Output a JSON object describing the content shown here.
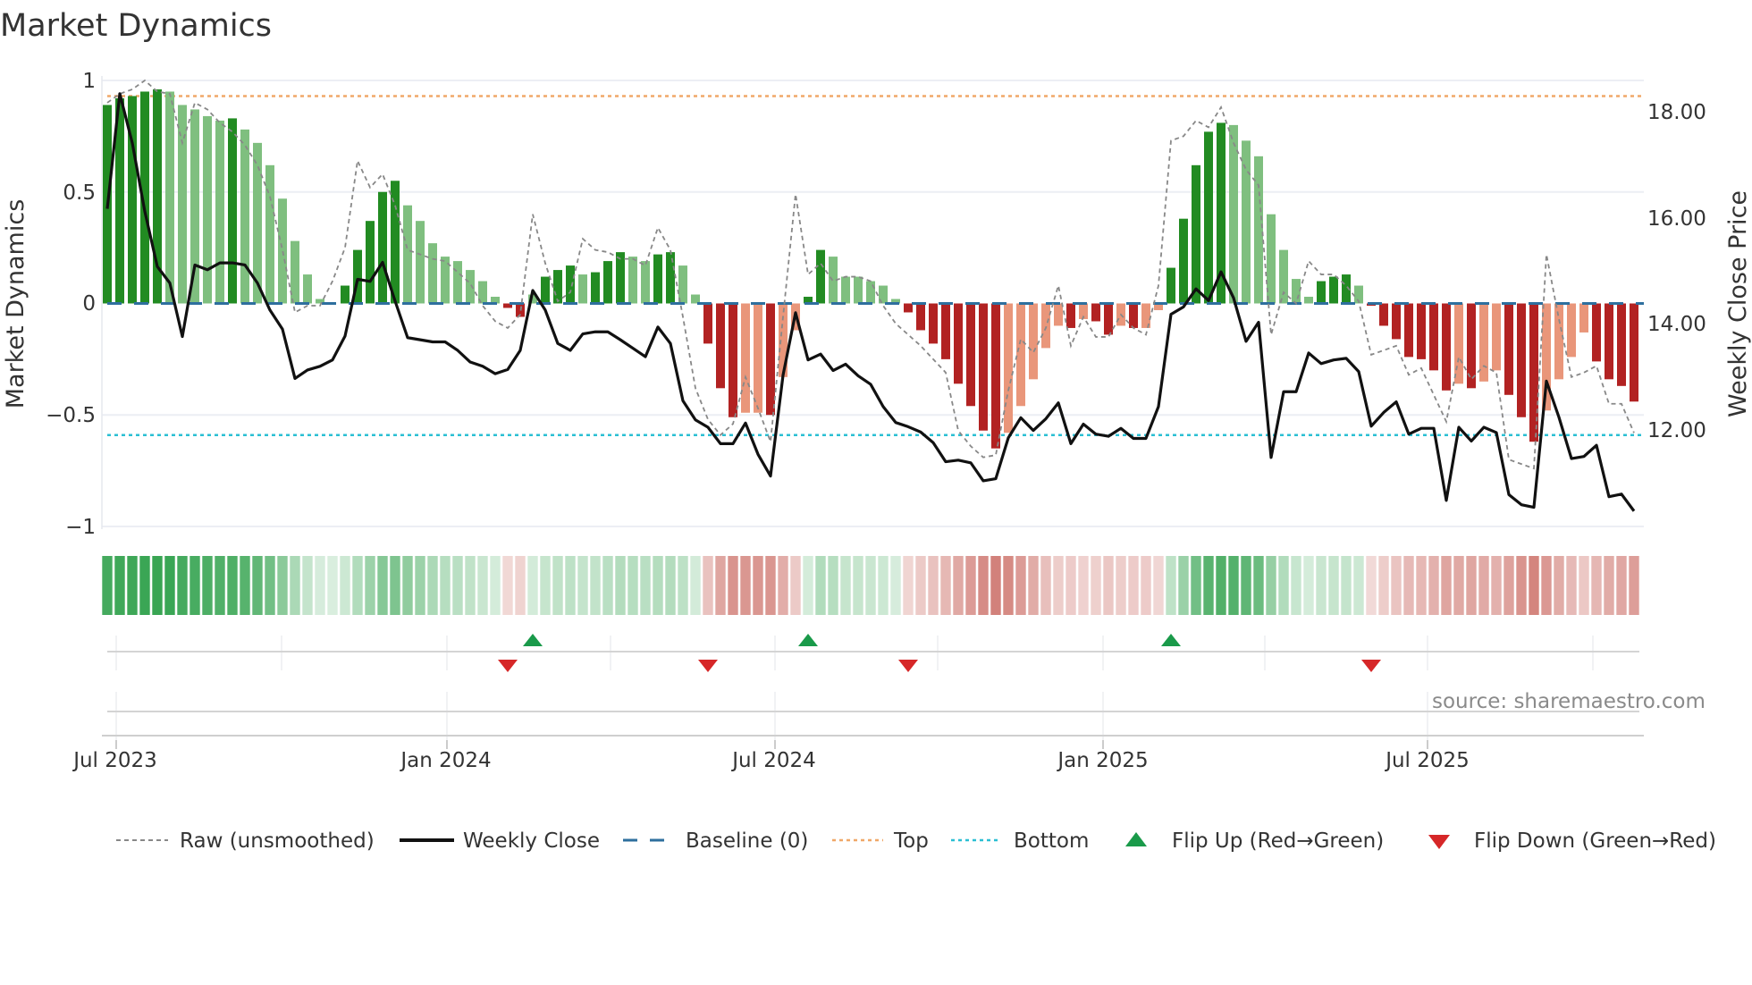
{
  "chart_data": {
    "type": "bar",
    "title": "Market Dynamics",
    "ylabel": "Market Dynamics",
    "ylabel_right": "Weekly Close Price",
    "ylim": [
      -1,
      1
    ],
    "ylim_right": [
      10.18,
      18.59
    ],
    "yticks_left": [
      "1",
      "0.5",
      "0",
      "−0.5",
      "−1"
    ],
    "yticks_left_values": [
      1,
      0.5,
      0,
      -0.5,
      -1
    ],
    "yticks_right": [
      "18.00",
      "16.00",
      "14.00",
      "12.00"
    ],
    "yticks_right_values": [
      18,
      16,
      14,
      12
    ],
    "xticks": [
      "Jul 2023",
      "Jan 2024",
      "Jul 2024",
      "Jan 2025",
      "Jul 2025"
    ],
    "xtick_week_index": [
      0.6,
      27,
      53.2,
      79.4,
      105.4
    ],
    "grid": true,
    "frequency": "weekly",
    "top_level": 0.93,
    "bottom_level": -0.59,
    "baseline": 0,
    "momentum": [
      0.89,
      0.92,
      0.93,
      0.95,
      0.96,
      0.95,
      0.89,
      0.87,
      0.84,
      0.82,
      0.83,
      0.78,
      0.72,
      0.62,
      0.47,
      0.28,
      0.13,
      0.02,
      0.0,
      0.08,
      0.24,
      0.37,
      0.5,
      0.55,
      0.44,
      0.37,
      0.27,
      0.21,
      0.19,
      0.15,
      0.1,
      0.03,
      -0.02,
      -0.06,
      0.04,
      0.12,
      0.15,
      0.17,
      0.13,
      0.14,
      0.19,
      0.23,
      0.21,
      0.19,
      0.22,
      0.23,
      0.17,
      0.04,
      -0.18,
      -0.38,
      -0.51,
      -0.49,
      -0.49,
      -0.5,
      -0.33,
      -0.12,
      0.03,
      0.24,
      0.21,
      0.12,
      0.12,
      0.1,
      0.08,
      0.02,
      -0.04,
      -0.12,
      -0.18,
      -0.25,
      -0.36,
      -0.46,
      -0.57,
      -0.65,
      -0.58,
      -0.46,
      -0.34,
      -0.2,
      -0.1,
      -0.11,
      -0.07,
      -0.08,
      -0.14,
      -0.1,
      -0.11,
      -0.11,
      -0.03,
      0.16,
      0.38,
      0.62,
      0.77,
      0.81,
      0.8,
      0.73,
      0.66,
      0.4,
      0.24,
      0.11,
      0.03,
      0.1,
      0.12,
      0.13,
      0.08,
      -0.01,
      -0.1,
      -0.16,
      -0.24,
      -0.25,
      -0.3,
      -0.39,
      -0.36,
      -0.38,
      -0.35,
      -0.3,
      -0.41,
      -0.51,
      -0.62,
      -0.48,
      -0.34,
      -0.24,
      -0.13,
      -0.26,
      -0.34,
      -0.37,
      -0.44
    ],
    "shades": "dddddlllll dlllllllld ddddllllll llddldddld ddllddlldd dlldllddll lllldddddd ddllllldld dldllddddd lllllllddd ldddddddld lldddlllld ddd",
    "weekly_close": [
      16.17,
      18.34,
      17.41,
      16.12,
      15.08,
      14.77,
      13.76,
      15.11,
      15.02,
      15.15,
      15.15,
      15.11,
      14.77,
      14.26,
      13.9,
      12.97,
      13.13,
      13.2,
      13.32,
      13.77,
      14.84,
      14.8,
      15.16,
      14.43,
      13.74,
      13.7,
      13.66,
      13.66,
      13.5,
      13.28,
      13.2,
      13.06,
      13.14,
      13.5,
      14.63,
      14.26,
      13.63,
      13.5,
      13.81,
      13.85,
      13.85,
      13.7,
      13.54,
      13.38,
      13.94,
      13.63,
      12.55,
      12.19,
      12.05,
      11.74,
      11.74,
      12.13,
      11.54,
      11.13,
      13.03,
      14.21,
      13.32,
      13.43,
      13.12,
      13.24,
      13.02,
      12.86,
      12.44,
      12.14,
      12.06,
      11.96,
      11.76,
      11.4,
      11.43,
      11.38,
      11.04,
      11.08,
      11.85,
      12.23,
      11.99,
      12.21,
      12.51,
      11.74,
      12.11,
      11.92,
      11.88,
      12.03,
      11.84,
      11.84,
      12.44,
      14.18,
      14.32,
      14.66,
      14.44,
      14.98,
      14.49,
      13.67,
      14.03,
      11.48,
      12.72,
      12.72,
      13.45,
      13.25,
      13.32,
      13.35,
      13.1,
      12.07,
      12.33,
      12.53,
      11.92,
      12.03,
      12.03,
      10.67,
      12.05,
      11.79,
      12.05,
      11.95,
      10.78,
      10.59,
      10.54,
      12.92,
      12.24,
      11.46,
      11.5,
      11.71,
      10.74,
      10.79,
      10.47
    ],
    "raw": [
      0.9,
      0.94,
      0.96,
      1.0,
      0.95,
      0.94,
      0.72,
      0.9,
      0.87,
      0.81,
      0.77,
      0.71,
      0.62,
      0.48,
      0.24,
      -0.04,
      -0.01,
      -0.01,
      0.1,
      0.25,
      0.64,
      0.52,
      0.58,
      0.44,
      0.24,
      0.22,
      0.2,
      0.19,
      0.14,
      0.09,
      -0.01,
      -0.08,
      -0.11,
      -0.05,
      0.4,
      0.18,
      0.01,
      0.05,
      0.29,
      0.24,
      0.23,
      0.2,
      0.2,
      0.17,
      0.34,
      0.24,
      -0.06,
      -0.38,
      -0.52,
      -0.59,
      -0.54,
      -0.33,
      -0.47,
      -0.62,
      -0.06,
      0.49,
      0.13,
      0.18,
      0.1,
      0.12,
      0.12,
      0.1,
      -0.01,
      -0.09,
      -0.14,
      -0.19,
      -0.25,
      -0.31,
      -0.57,
      -0.64,
      -0.69,
      -0.68,
      -0.39,
      -0.16,
      -0.22,
      -0.11,
      0.08,
      -0.19,
      -0.06,
      -0.15,
      -0.15,
      -0.05,
      -0.11,
      -0.14,
      0.08,
      0.73,
      0.75,
      0.82,
      0.79,
      0.88,
      0.72,
      0.6,
      0.53,
      -0.14,
      0.05,
      0.0,
      0.19,
      0.13,
      0.13,
      0.08,
      0.01,
      -0.23,
      -0.21,
      -0.19,
      -0.32,
      -0.29,
      -0.41,
      -0.53,
      -0.24,
      -0.34,
      -0.28,
      -0.31,
      -0.7,
      -0.72,
      -0.74,
      0.22,
      -0.07,
      -0.33,
      -0.31,
      -0.28,
      -0.45,
      -0.45,
      -0.58
    ],
    "flip_up_index": [
      34,
      56,
      85
    ],
    "flip_down_index": [
      32,
      48,
      64,
      101
    ],
    "legend": [
      "Raw (unsmoothed)",
      "Weekly Close",
      "Baseline (0)",
      "Top",
      "Bottom",
      "Flip Up (Red→Green)",
      "Flip Down (Green→Red)"
    ],
    "legend_position": "bottom",
    "source": "source: sharemaestro.com",
    "colors": {
      "green_dark": "#228b22",
      "green_light": "#7fbf7f",
      "red_dark": "#b22222",
      "red_light": "#e9967a",
      "raw": "#888888",
      "close": "#111111",
      "baseline": "#2e6f9e",
      "top": "#f0a868",
      "bottom": "#2bbfd3",
      "flip_up": "#1a9a4a",
      "flip_down": "#d62728"
    }
  }
}
